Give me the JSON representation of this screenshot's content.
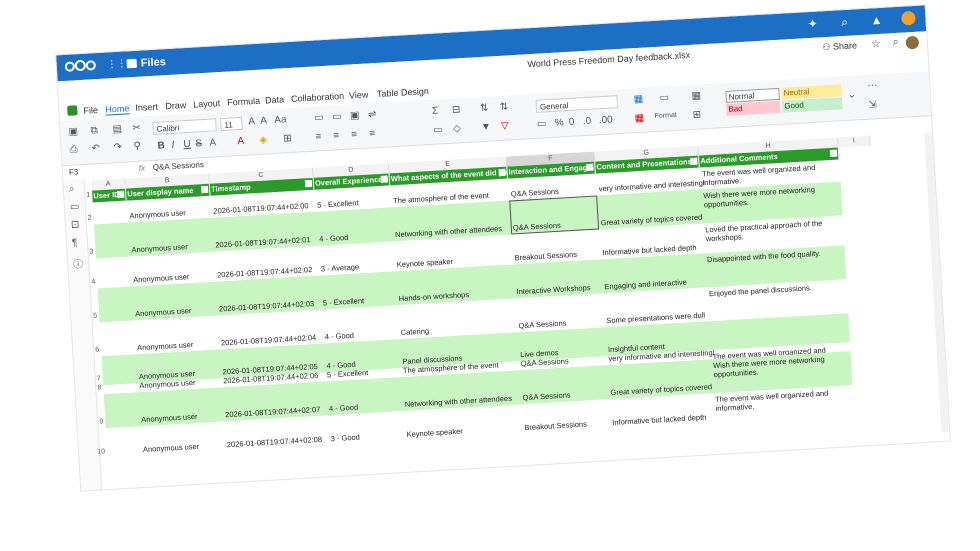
{
  "app": {
    "name": "Files",
    "document_title": "World Press Freedom Day feedback.xlsx",
    "share_label": "Share"
  },
  "menu": [
    "File",
    "Home",
    "Insert",
    "Draw",
    "Layout",
    "Formula",
    "Data",
    "Collaboration",
    "View",
    "Table Design"
  ],
  "toolbar": {
    "font": "Calibri",
    "size": "11",
    "number_format": "General",
    "format_label": "Format",
    "styles": {
      "normal": "Normal",
      "neutral": "Neutral",
      "bad": "Bad",
      "good": "Good"
    }
  },
  "formula_bar": {
    "cell_ref": "F3",
    "fx": "fx",
    "value": "Q&A Sessions"
  },
  "columns": [
    "A",
    "B",
    "C",
    "D",
    "E",
    "F",
    "G",
    "H",
    "I"
  ],
  "headers": [
    "User ID",
    "User display name",
    "Timestamp",
    "Overall Experience",
    "What aspects of the event did you",
    "Interaction and Engage",
    "Content and Presentations",
    "Additional Comments"
  ],
  "rows": [
    {
      "num": "1",
      "b": "",
      "c": "",
      "d": "",
      "e": "",
      "f": "",
      "g": "",
      "h": ""
    },
    {
      "num": "2",
      "b": "Anonymous user",
      "c": "2026-01-08T19:07:44+02:00",
      "d": "5 - Excellent",
      "e": "The atmosphere of the event",
      "f": "Q&A Sessions",
      "g": "very informative and interesting!",
      "h": "The event was well organized and informative."
    },
    {
      "num": "3",
      "b": "Anonymous user",
      "c": "2026-01-08T19:07:44+02:01",
      "d": "4 - Good",
      "e": "Networking with other attendees",
      "f": "Q&A Sessions",
      "g": "Great variety of topics covered",
      "h": "Wish there were more networking opportunities."
    },
    {
      "num": "4",
      "b": "Anonymous user",
      "c": "2026-01-08T19:07:44+02:02",
      "d": "3 - Average",
      "e": "Keynote speaker",
      "f": "Breakout Sessions",
      "g": "Informative but lacked depth",
      "h": "Loved the practical approach of the workshops."
    },
    {
      "num": "5",
      "b": "Anonymous user",
      "c": "2026-01-08T19:07:44+02:03",
      "d": "5 - Excellent",
      "e": "Hands-on workshops",
      "f": "Interactive Workshops",
      "g": "Engaging and interactive",
      "h": "Disappointed with the food quality."
    },
    {
      "num": "6",
      "b": "Anonymous user",
      "c": "2026-01-08T19:07:44+02:04",
      "d": "4 - Good",
      "e": "Catering",
      "f": "Q&A Sessions",
      "g": "Some presentations were dull",
      "h": "Enjoyed the panel discussions."
    },
    {
      "num": "7",
      "b": "Anonymous user",
      "c": "2026-01-08T19:07:44+02:05",
      "d": "4 - Good",
      "e": "Panel discussions",
      "f": "Live demos",
      "g": "Insightful content",
      "h": ""
    },
    {
      "num": "8",
      "b": "Anonymous user",
      "c": "2026-01-08T19:07:44+02:06",
      "d": "5 - Excellent",
      "e": "The atmosphere of the event",
      "f": "Q&A Sessions",
      "g": "very informative and interesting!",
      "h": "The event was well organized and informative."
    },
    {
      "num": "9",
      "b": "Anonymous user",
      "c": "2026-01-08T19:07:44+02:07",
      "d": "4 - Good",
      "e": "Networking with other attendees",
      "f": "Q&A Sessions",
      "g": "Great variety of topics covered",
      "h": "Wish there were more networking opportunities."
    },
    {
      "num": "10",
      "b": "Anonymous user",
      "c": "2026-01-08T19:07:44+02:08",
      "d": "3 - Good",
      "e": "Keynote speaker",
      "f": "Breakout Sessions",
      "g": "Informative but lacked depth",
      "h": "The event was well organized and informative."
    }
  ],
  "colors": {
    "topbar": "#1c6fc4",
    "header_green": "#2b9a2b",
    "band_green": "#c9f5c2"
  }
}
